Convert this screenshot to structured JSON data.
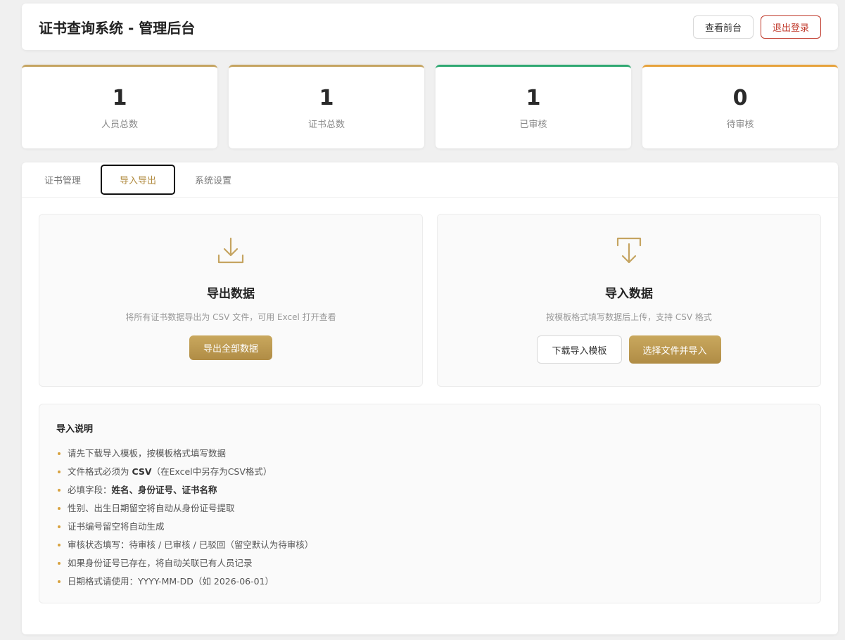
{
  "header": {
    "title": "证书查询系统 - 管理后台",
    "view_frontend": "查看前台",
    "logout": "退出登录"
  },
  "stats": [
    {
      "value": "1",
      "label": "人员总数",
      "color": "#c5a461"
    },
    {
      "value": "1",
      "label": "证书总数",
      "color": "#c5a461"
    },
    {
      "value": "1",
      "label": "已审核",
      "color": "#2fa872"
    },
    {
      "value": "0",
      "label": "待审核",
      "color": "#e6a23c"
    }
  ],
  "tabs": [
    {
      "label": "证书管理",
      "active": false
    },
    {
      "label": "导入导出",
      "active": true
    },
    {
      "label": "系统设置",
      "active": false
    }
  ],
  "export_card": {
    "icon": "download-icon",
    "title": "导出数据",
    "desc": "将所有证书数据导出为 CSV 文件，可用 Excel 打开查看",
    "button": "导出全部数据"
  },
  "import_card": {
    "icon": "import-icon",
    "title": "导入数据",
    "desc": "按模板格式填写数据后上传，支持 CSV 格式",
    "template_button": "下载导入模板",
    "import_button": "选择文件并导入"
  },
  "notes": {
    "title": "导入说明",
    "items": [
      {
        "pre": "请先下载导入模板，按模板格式填写数据",
        "bold": "",
        "post": ""
      },
      {
        "pre": "文件格式必须为 ",
        "bold": "CSV",
        "post": "（在Excel中另存为CSV格式）"
      },
      {
        "pre": "必填字段：",
        "bold": "姓名、身份证号、证书名称",
        "post": ""
      },
      {
        "pre": "性别、出生日期留空将自动从身份证号提取",
        "bold": "",
        "post": ""
      },
      {
        "pre": "证书编号留空将自动生成",
        "bold": "",
        "post": ""
      },
      {
        "pre": "审核状态填写：待审核 / 已审核 / 已驳回（留空默认为待审核）",
        "bold": "",
        "post": ""
      },
      {
        "pre": "如果身份证号已存在，将自动关联已有人员记录",
        "bold": "",
        "post": ""
      },
      {
        "pre": "日期格式请使用：YYYY-MM-DD（如 2026-06-01）",
        "bold": "",
        "post": ""
      }
    ]
  },
  "accent_color": "#c5a461"
}
